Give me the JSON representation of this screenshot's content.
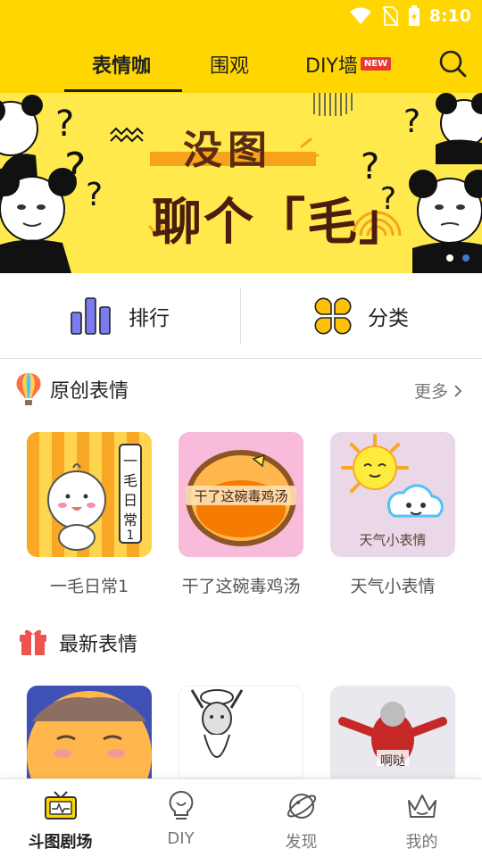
{
  "status_bar": {
    "time": "8:10"
  },
  "top_nav": {
    "tabs": [
      {
        "label": "表情咖",
        "active": true
      },
      {
        "label": "围观",
        "active": false
      },
      {
        "label": "DIY墙",
        "active": false
      }
    ],
    "new_badge": "NEW",
    "search_icon": "search-icon"
  },
  "banner": {
    "line1": "没图",
    "line2": "聊个「毛」",
    "dots": 2,
    "active_dot": 1
  },
  "quick_actions": [
    {
      "label": "排行",
      "icon": "bar-chart-icon"
    },
    {
      "label": "分类",
      "icon": "category-grid-icon"
    }
  ],
  "original_section": {
    "title": "原创表情",
    "more": "更多",
    "items": [
      {
        "label": "一毛日常1",
        "art_text": "一毛日常1"
      },
      {
        "label": "干了这碗毒鸡汤",
        "art_text": "干了这碗毒鸡汤"
      },
      {
        "label": "天气小表情",
        "art_text": "天气小表情"
      }
    ]
  },
  "latest_section": {
    "title": "最新表情",
    "items": [
      {
        "art_text": ""
      },
      {
        "art_text": ""
      },
      {
        "art_text": "啊哒"
      }
    ]
  },
  "bottom_nav": [
    {
      "label": "斗图剧场",
      "icon": "tv-icon",
      "active": true
    },
    {
      "label": "DIY",
      "icon": "lightbulb-icon",
      "active": false
    },
    {
      "label": "发现",
      "icon": "planet-icon",
      "active": false
    },
    {
      "label": "我的",
      "icon": "crown-icon",
      "active": false
    }
  ],
  "colors": {
    "brand_yellow": "#FFD600",
    "banner_yellow": "#FFE94D",
    "accent_red": "#e53935"
  }
}
